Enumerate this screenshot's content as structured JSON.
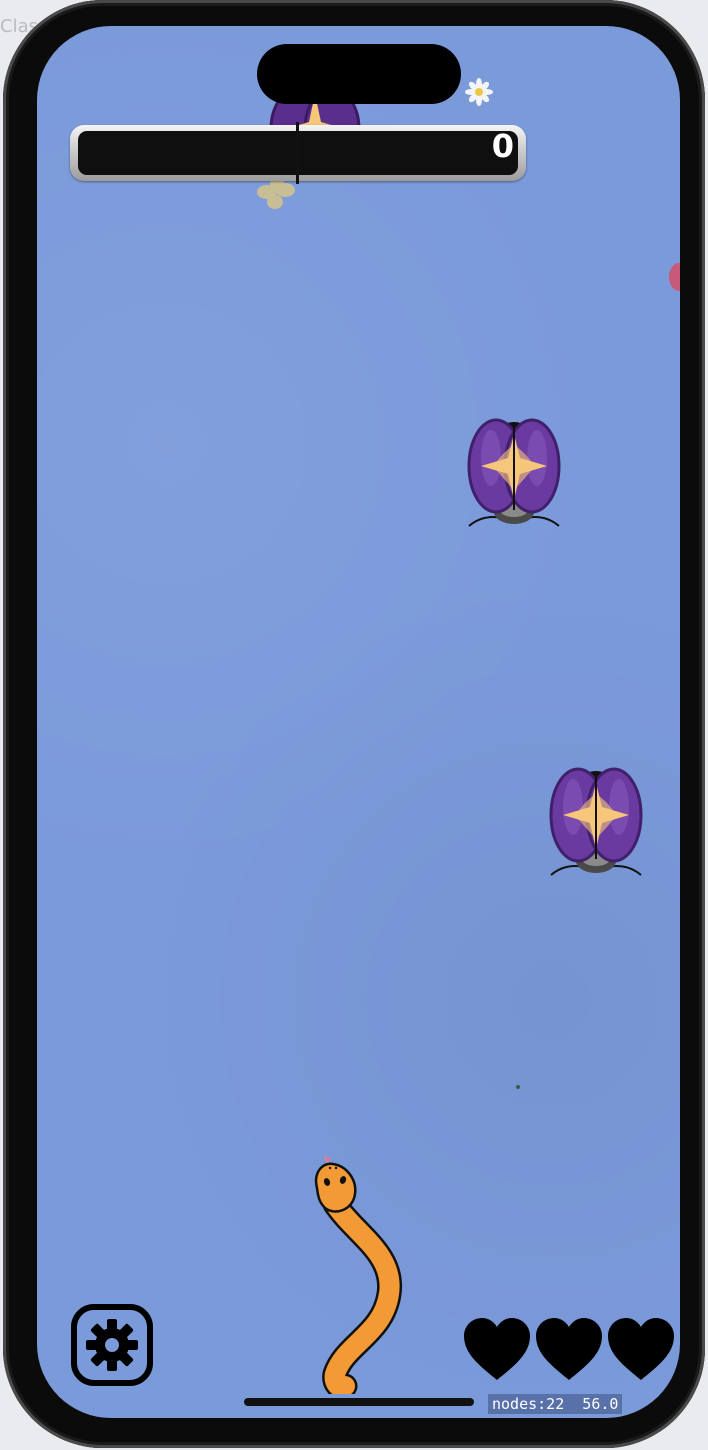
{
  "hud": {
    "score": "0",
    "lives": 3
  },
  "debug": {
    "stats": "nodes:22  56.0"
  },
  "background_edge_text": {
    "top_left": "Clas"
  },
  "colors": {
    "water": "#7b9ada",
    "snake": "#f29a35",
    "beetle_shell": "#6a3aa0",
    "star": "#f6c67a",
    "heart": "#000000"
  },
  "icons": {
    "settings": "gear-icon",
    "lives": "heart-icon",
    "player": "snake",
    "enemy": "beetle"
  }
}
